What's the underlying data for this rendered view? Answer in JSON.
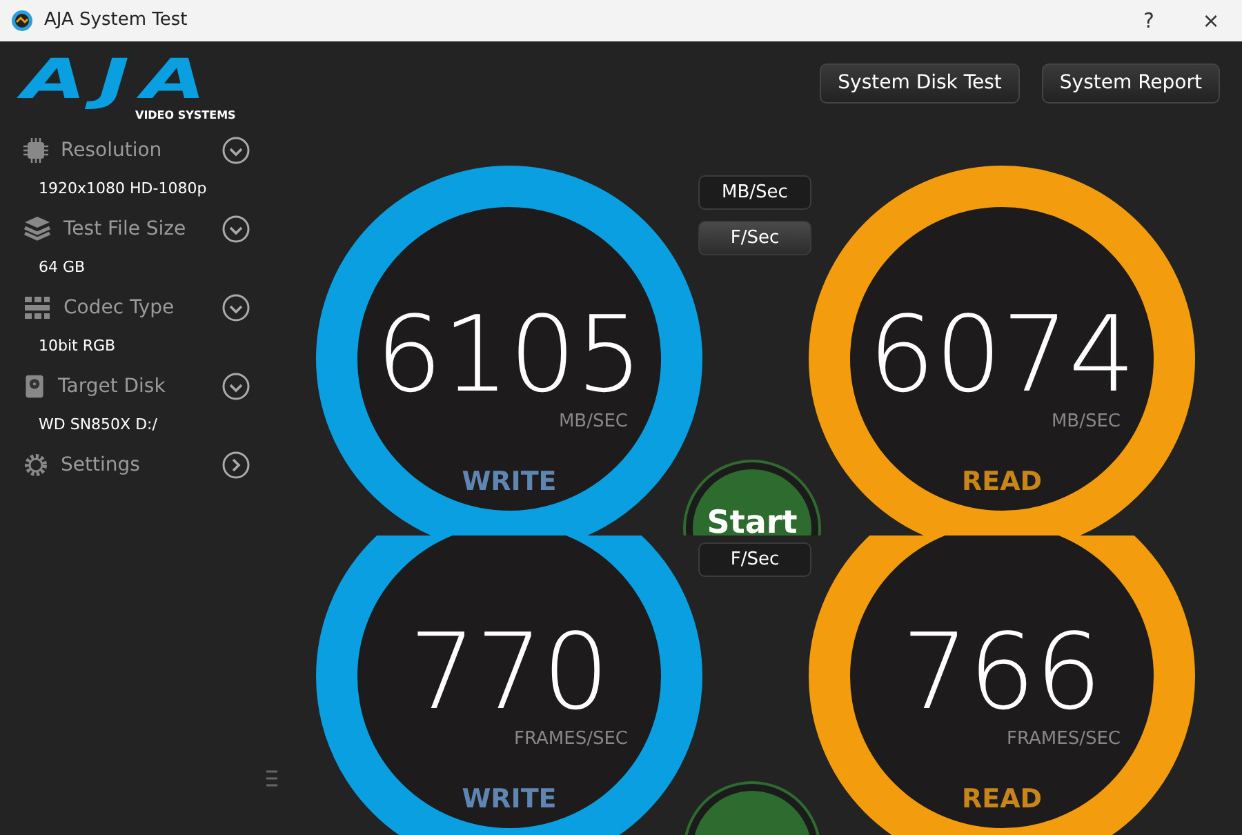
{
  "window": {
    "title": "AJA System Test",
    "help": "?",
    "close": "×"
  },
  "logo": {
    "mark": "AJA",
    "tagline": "VIDEO SYSTEMS"
  },
  "sidebar": {
    "items": [
      {
        "label": "Resolution",
        "kind": "dropdown",
        "value": "1920x1080 HD-1080p"
      },
      {
        "label": "Test File Size",
        "kind": "dropdown",
        "value": "64 GB"
      },
      {
        "label": "Codec Type",
        "kind": "dropdown",
        "value": "10bit RGB"
      },
      {
        "label": "Target Disk",
        "kind": "dropdown",
        "value": "WD SN850X D:/"
      },
      {
        "label": "Settings",
        "kind": "link"
      }
    ]
  },
  "header_buttons": [
    "System Disk Test",
    "System Report"
  ],
  "panels": [
    {
      "unit_toggles": [
        {
          "label": "MB/Sec",
          "selected": false
        },
        {
          "label": "F/Sec",
          "selected": true
        }
      ],
      "gauges": [
        {
          "kind": "write",
          "color": "#0a9fe0",
          "value": "6105",
          "unit": "MB/SEC",
          "label": "WRITE"
        },
        {
          "kind": "read",
          "color": "#f39c0e",
          "value": "6074",
          "unit": "MB/SEC",
          "label": "READ"
        }
      ],
      "start_button": {
        "label": "Start"
      }
    },
    {
      "unit_toggles": [
        {
          "label": "F/Sec",
          "selected": false
        }
      ],
      "gauges": [
        {
          "kind": "write",
          "color": "#0a9fe0",
          "value": "770",
          "unit": "FRAMES/SEC",
          "label": "WRITE"
        },
        {
          "kind": "read",
          "color": "#f39c0e",
          "value": "766",
          "unit": "FRAMES/SEC",
          "label": "READ"
        }
      ]
    }
  ]
}
